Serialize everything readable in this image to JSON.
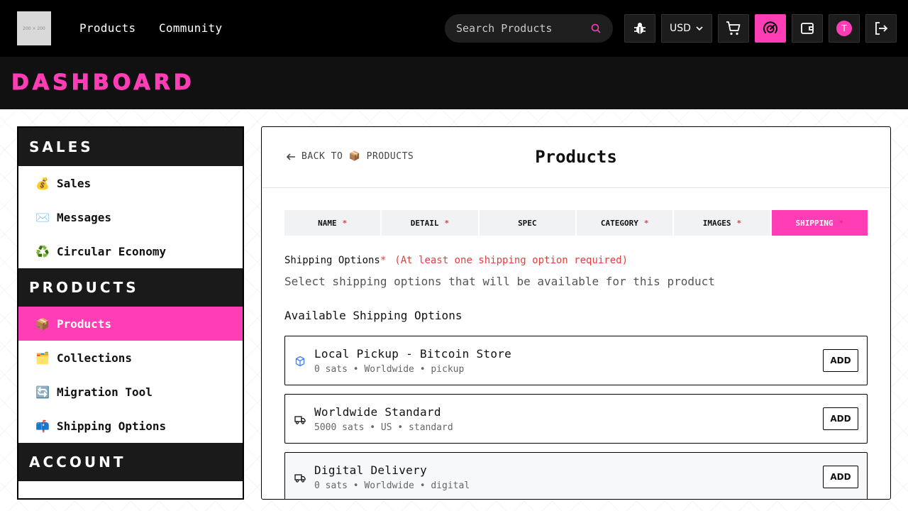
{
  "nav": {
    "logo_text": "200 × 200",
    "links": [
      "Products",
      "Community"
    ],
    "search_placeholder": "Search Products",
    "currency": "USD",
    "avatar_initial": "T"
  },
  "dashboard": {
    "title": "DASHBOARD"
  },
  "sidebar": {
    "sections": [
      {
        "title": "SALES",
        "items": [
          {
            "emoji": "💰",
            "label": "Sales"
          },
          {
            "emoji": "✉️",
            "label": "Messages"
          },
          {
            "emoji": "♻️",
            "label": "Circular Economy"
          }
        ]
      },
      {
        "title": "PRODUCTS",
        "items": [
          {
            "emoji": "📦",
            "label": "Products",
            "active": true
          },
          {
            "emoji": "🗂️",
            "label": "Collections"
          },
          {
            "emoji": "🔄",
            "label": "Migration Tool"
          },
          {
            "emoji": "📫",
            "label": "Shipping Options"
          }
        ]
      },
      {
        "title": "ACCOUNT",
        "items": []
      }
    ]
  },
  "panel": {
    "back_label": "BACK TO 📦 PRODUCTS",
    "title": "Products",
    "tabs": [
      {
        "label": "NAME",
        "required": true
      },
      {
        "label": "DETAIL",
        "required": true
      },
      {
        "label": "SPEC",
        "required": false
      },
      {
        "label": "CATEGORY",
        "required": true
      },
      {
        "label": "IMAGES",
        "required": true
      },
      {
        "label": "SHIPPING",
        "required": true,
        "active": true
      }
    ],
    "required_mark": "*",
    "shipping_label": "Shipping Options",
    "shipping_hint": "(At least one shipping option required)",
    "subtext": "Select shipping options that will be available for this product",
    "available_heading": "Available Shipping Options",
    "add_label": "ADD",
    "options": [
      {
        "name": "Local Pickup - Bitcoin Store",
        "meta": "0 sats • Worldwide • pickup",
        "icon": "package-icon"
      },
      {
        "name": "Worldwide Standard",
        "meta": "5000 sats • US • standard",
        "icon": "truck-icon"
      },
      {
        "name": "Digital Delivery",
        "meta": "0 sats • Worldwide • digital",
        "icon": "truck-icon"
      }
    ]
  },
  "colors": {
    "accent": "#ff3eb5",
    "required": "#e53e3e",
    "topbar": "#000000"
  }
}
